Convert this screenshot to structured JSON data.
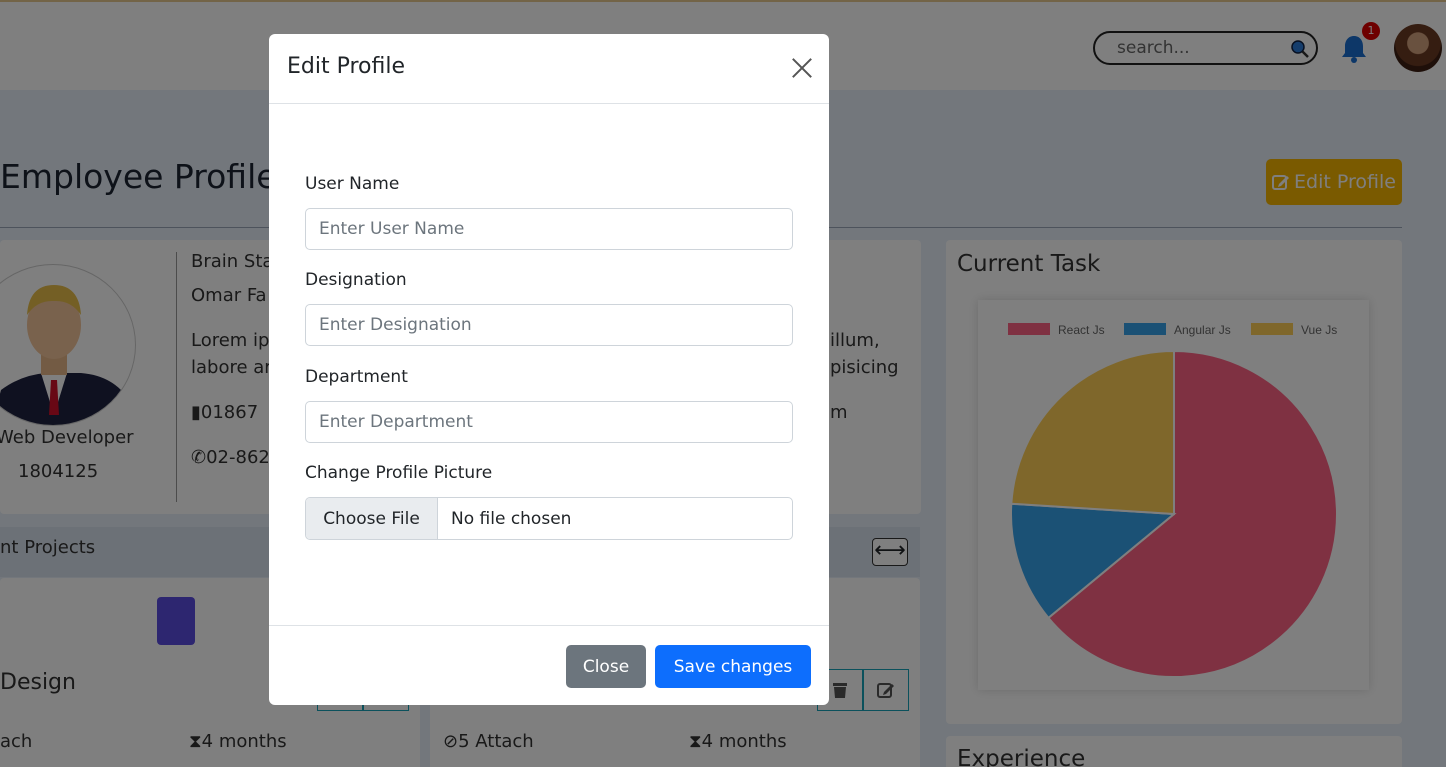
{
  "header": {
    "search_placeholder": "search...",
    "notification_count": "1"
  },
  "page": {
    "title": "Employee Profile",
    "edit_button_label": "Edit Profile"
  },
  "profile": {
    "role": "Web Developer",
    "id": "1804125",
    "company": "Brain Sta",
    "name": "Omar Fa",
    "bio_line1": "Lorem ip",
    "bio_line2": "labore ar",
    "bio_right1": "illum,",
    "bio_right2": "pisicing",
    "bio_right3": "m",
    "mobile": "01867",
    "phone": "02-862"
  },
  "projects": {
    "header": "nt Projects",
    "card1_title": "Design",
    "card1_attach": "ach",
    "card1_duration": "4 months",
    "card2_attach": "5 Attach",
    "card2_duration": "4 months"
  },
  "task": {
    "title": "Current Task"
  },
  "experience": {
    "title": "Experience"
  },
  "modal": {
    "title": "Edit Profile",
    "username_label": "User Name",
    "username_placeholder": "Enter User Name",
    "designation_label": "Designation",
    "designation_placeholder": "Enter Designation",
    "department_label": "Department",
    "department_placeholder": "Enter Department",
    "picture_label": "Change Profile Picture",
    "choose_file_label": "Choose File",
    "no_file_text": "No file chosen",
    "close_label": "Close",
    "save_label": "Save changes"
  },
  "chart_data": {
    "type": "pie",
    "categories": [
      "React Js",
      "Angular Js",
      "Vue Js"
    ],
    "values": [
      64,
      12,
      24
    ],
    "colors": [
      "#ff6384",
      "#36a2eb",
      "#ffce56"
    ],
    "legend": "top"
  }
}
